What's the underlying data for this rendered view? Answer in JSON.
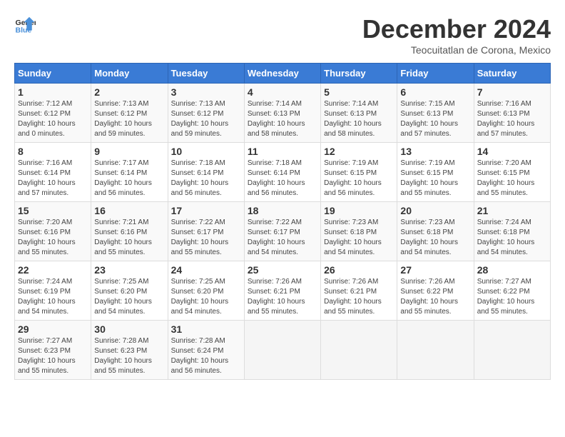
{
  "header": {
    "logo_line1": "General",
    "logo_line2": "Blue",
    "title": "December 2024",
    "subtitle": "Teocuitatlan de Corona, Mexico"
  },
  "weekdays": [
    "Sunday",
    "Monday",
    "Tuesday",
    "Wednesday",
    "Thursday",
    "Friday",
    "Saturday"
  ],
  "weeks": [
    [
      {
        "day": "1",
        "sunrise": "7:12 AM",
        "sunset": "6:12 PM",
        "daylight": "10 hours and 0 minutes."
      },
      {
        "day": "2",
        "sunrise": "7:13 AM",
        "sunset": "6:12 PM",
        "daylight": "10 hours and 59 minutes."
      },
      {
        "day": "3",
        "sunrise": "7:13 AM",
        "sunset": "6:12 PM",
        "daylight": "10 hours and 59 minutes."
      },
      {
        "day": "4",
        "sunrise": "7:14 AM",
        "sunset": "6:13 PM",
        "daylight": "10 hours and 58 minutes."
      },
      {
        "day": "5",
        "sunrise": "7:14 AM",
        "sunset": "6:13 PM",
        "daylight": "10 hours and 58 minutes."
      },
      {
        "day": "6",
        "sunrise": "7:15 AM",
        "sunset": "6:13 PM",
        "daylight": "10 hours and 57 minutes."
      },
      {
        "day": "7",
        "sunrise": "7:16 AM",
        "sunset": "6:13 PM",
        "daylight": "10 hours and 57 minutes."
      }
    ],
    [
      {
        "day": "8",
        "sunrise": "7:16 AM",
        "sunset": "6:14 PM",
        "daylight": "10 hours and 57 minutes."
      },
      {
        "day": "9",
        "sunrise": "7:17 AM",
        "sunset": "6:14 PM",
        "daylight": "10 hours and 56 minutes."
      },
      {
        "day": "10",
        "sunrise": "7:18 AM",
        "sunset": "6:14 PM",
        "daylight": "10 hours and 56 minutes."
      },
      {
        "day": "11",
        "sunrise": "7:18 AM",
        "sunset": "6:14 PM",
        "daylight": "10 hours and 56 minutes."
      },
      {
        "day": "12",
        "sunrise": "7:19 AM",
        "sunset": "6:15 PM",
        "daylight": "10 hours and 56 minutes."
      },
      {
        "day": "13",
        "sunrise": "7:19 AM",
        "sunset": "6:15 PM",
        "daylight": "10 hours and 55 minutes."
      },
      {
        "day": "14",
        "sunrise": "7:20 AM",
        "sunset": "6:15 PM",
        "daylight": "10 hours and 55 minutes."
      }
    ],
    [
      {
        "day": "15",
        "sunrise": "7:20 AM",
        "sunset": "6:16 PM",
        "daylight": "10 hours and 55 minutes."
      },
      {
        "day": "16",
        "sunrise": "7:21 AM",
        "sunset": "6:16 PM",
        "daylight": "10 hours and 55 minutes."
      },
      {
        "day": "17",
        "sunrise": "7:22 AM",
        "sunset": "6:17 PM",
        "daylight": "10 hours and 55 minutes."
      },
      {
        "day": "18",
        "sunrise": "7:22 AM",
        "sunset": "6:17 PM",
        "daylight": "10 hours and 54 minutes."
      },
      {
        "day": "19",
        "sunrise": "7:23 AM",
        "sunset": "6:18 PM",
        "daylight": "10 hours and 54 minutes."
      },
      {
        "day": "20",
        "sunrise": "7:23 AM",
        "sunset": "6:18 PM",
        "daylight": "10 hours and 54 minutes."
      },
      {
        "day": "21",
        "sunrise": "7:24 AM",
        "sunset": "6:18 PM",
        "daylight": "10 hours and 54 minutes."
      }
    ],
    [
      {
        "day": "22",
        "sunrise": "7:24 AM",
        "sunset": "6:19 PM",
        "daylight": "10 hours and 54 minutes."
      },
      {
        "day": "23",
        "sunrise": "7:25 AM",
        "sunset": "6:20 PM",
        "daylight": "10 hours and 54 minutes."
      },
      {
        "day": "24",
        "sunrise": "7:25 AM",
        "sunset": "6:20 PM",
        "daylight": "10 hours and 54 minutes."
      },
      {
        "day": "25",
        "sunrise": "7:26 AM",
        "sunset": "6:21 PM",
        "daylight": "10 hours and 55 minutes."
      },
      {
        "day": "26",
        "sunrise": "7:26 AM",
        "sunset": "6:21 PM",
        "daylight": "10 hours and 55 minutes."
      },
      {
        "day": "27",
        "sunrise": "7:26 AM",
        "sunset": "6:22 PM",
        "daylight": "10 hours and 55 minutes."
      },
      {
        "day": "28",
        "sunrise": "7:27 AM",
        "sunset": "6:22 PM",
        "daylight": "10 hours and 55 minutes."
      }
    ],
    [
      {
        "day": "29",
        "sunrise": "7:27 AM",
        "sunset": "6:23 PM",
        "daylight": "10 hours and 55 minutes."
      },
      {
        "day": "30",
        "sunrise": "7:28 AM",
        "sunset": "6:23 PM",
        "daylight": "10 hours and 55 minutes."
      },
      {
        "day": "31",
        "sunrise": "7:28 AM",
        "sunset": "6:24 PM",
        "daylight": "10 hours and 56 minutes."
      },
      null,
      null,
      null,
      null
    ]
  ]
}
